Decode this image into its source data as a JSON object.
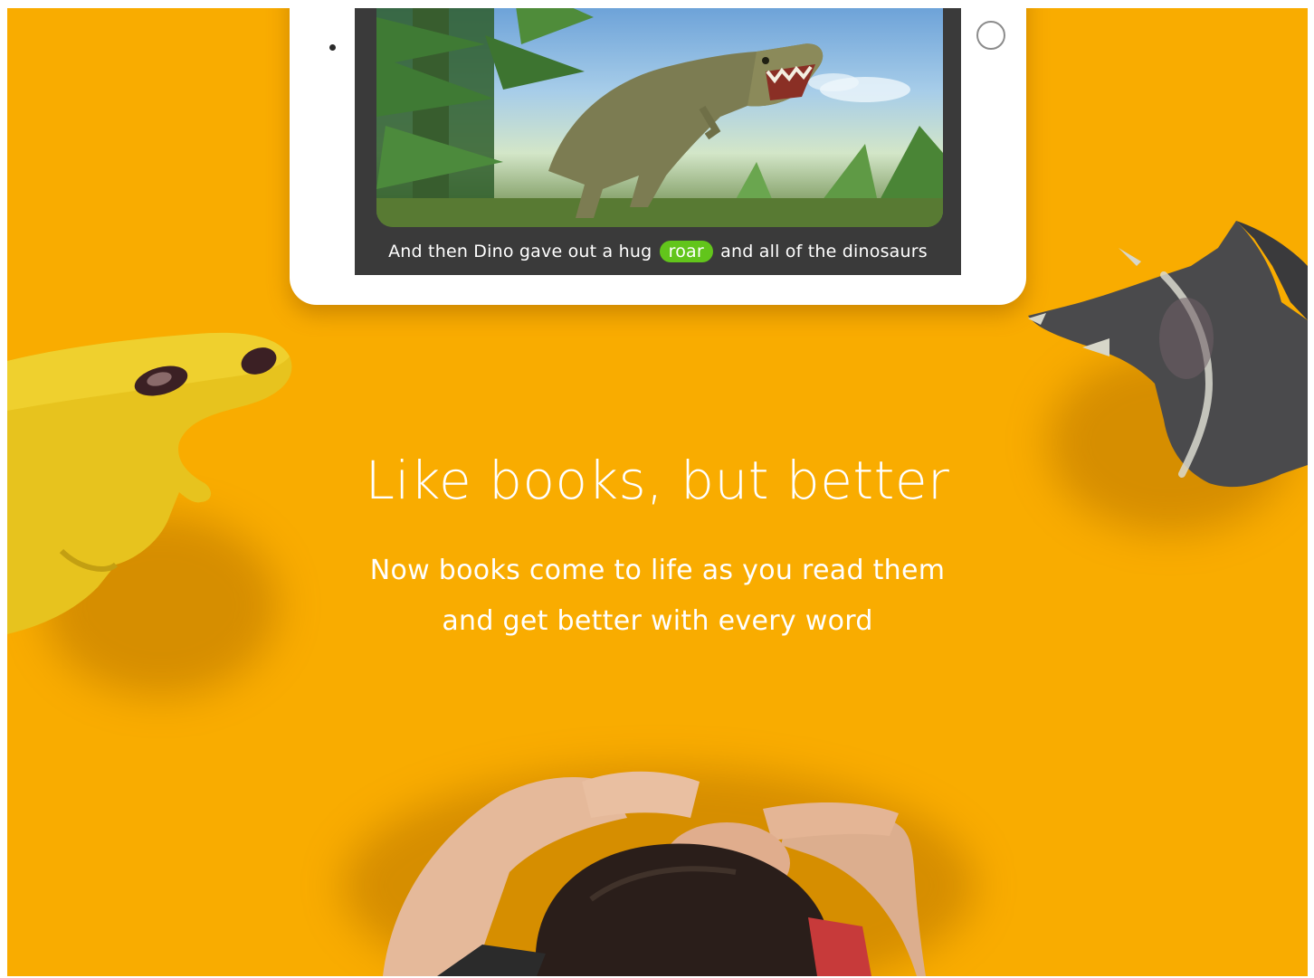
{
  "tablet": {
    "caption_before": "And then Dino gave out a hug",
    "caption_highlight": "roar",
    "caption_after": "and all of the dinosaurs"
  },
  "hero": {
    "headline": "Like books, but better",
    "subline_1": "Now books come to life as you read them",
    "subline_2": "and get better with every word"
  },
  "colors": {
    "background": "#f9ac00",
    "highlight": "#62c51b",
    "text": "#ffffff"
  }
}
